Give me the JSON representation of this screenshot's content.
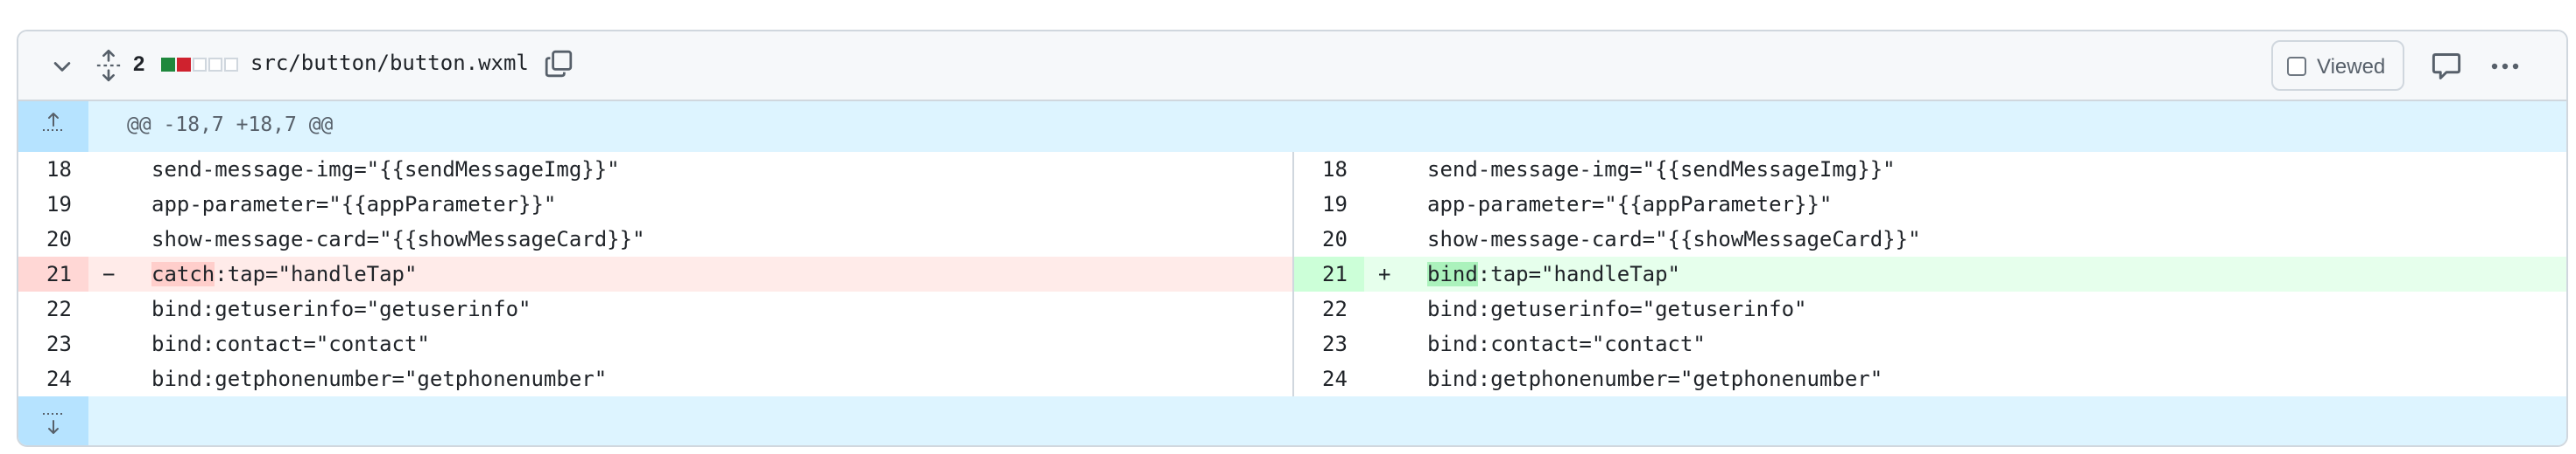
{
  "header": {
    "changes_count": "2",
    "diffstat": [
      "add",
      "del",
      "neutral",
      "neutral",
      "neutral"
    ],
    "file_name": "src/button/button.wxml",
    "viewed_label": "Viewed"
  },
  "hunk": {
    "text": "@@ -18,7 +18,7 @@"
  },
  "left": [
    {
      "num": "18",
      "sign": "",
      "code": "send-message-img=\"{{sendMessageImg}}\"",
      "type": "ctx"
    },
    {
      "num": "19",
      "sign": "",
      "code": "app-parameter=\"{{appParameter}}\"",
      "type": "ctx"
    },
    {
      "num": "20",
      "sign": "",
      "code": "show-message-card=\"{{showMessageCard}}\"",
      "type": "ctx"
    },
    {
      "num": "21",
      "sign": "−",
      "hl": "catch",
      "code": ":tap=\"handleTap\"",
      "type": "del"
    },
    {
      "num": "22",
      "sign": "",
      "code": "bind:getuserinfo=\"getuserinfo\"",
      "type": "ctx"
    },
    {
      "num": "23",
      "sign": "",
      "code": "bind:contact=\"contact\"",
      "type": "ctx"
    },
    {
      "num": "24",
      "sign": "",
      "code": "bind:getphonenumber=\"getphonenumber\"",
      "type": "ctx"
    }
  ],
  "right": [
    {
      "num": "18",
      "sign": "",
      "code": "send-message-img=\"{{sendMessageImg}}\"",
      "type": "ctx"
    },
    {
      "num": "19",
      "sign": "",
      "code": "app-parameter=\"{{appParameter}}\"",
      "type": "ctx"
    },
    {
      "num": "20",
      "sign": "",
      "code": "show-message-card=\"{{showMessageCard}}\"",
      "type": "ctx"
    },
    {
      "num": "21",
      "sign": "+",
      "hl": "bind",
      "code": ":tap=\"handleTap\"",
      "type": "add"
    },
    {
      "num": "22",
      "sign": "",
      "code": "bind:getuserinfo=\"getuserinfo\"",
      "type": "ctx"
    },
    {
      "num": "23",
      "sign": "",
      "code": "bind:contact=\"contact\"",
      "type": "ctx"
    },
    {
      "num": "24",
      "sign": "",
      "code": "bind:getphonenumber=\"getphonenumber\"",
      "type": "ctx"
    }
  ],
  "colors": {
    "add": "#1f883d",
    "del": "#cf222e",
    "hunk_bg": "#ddf4ff"
  }
}
